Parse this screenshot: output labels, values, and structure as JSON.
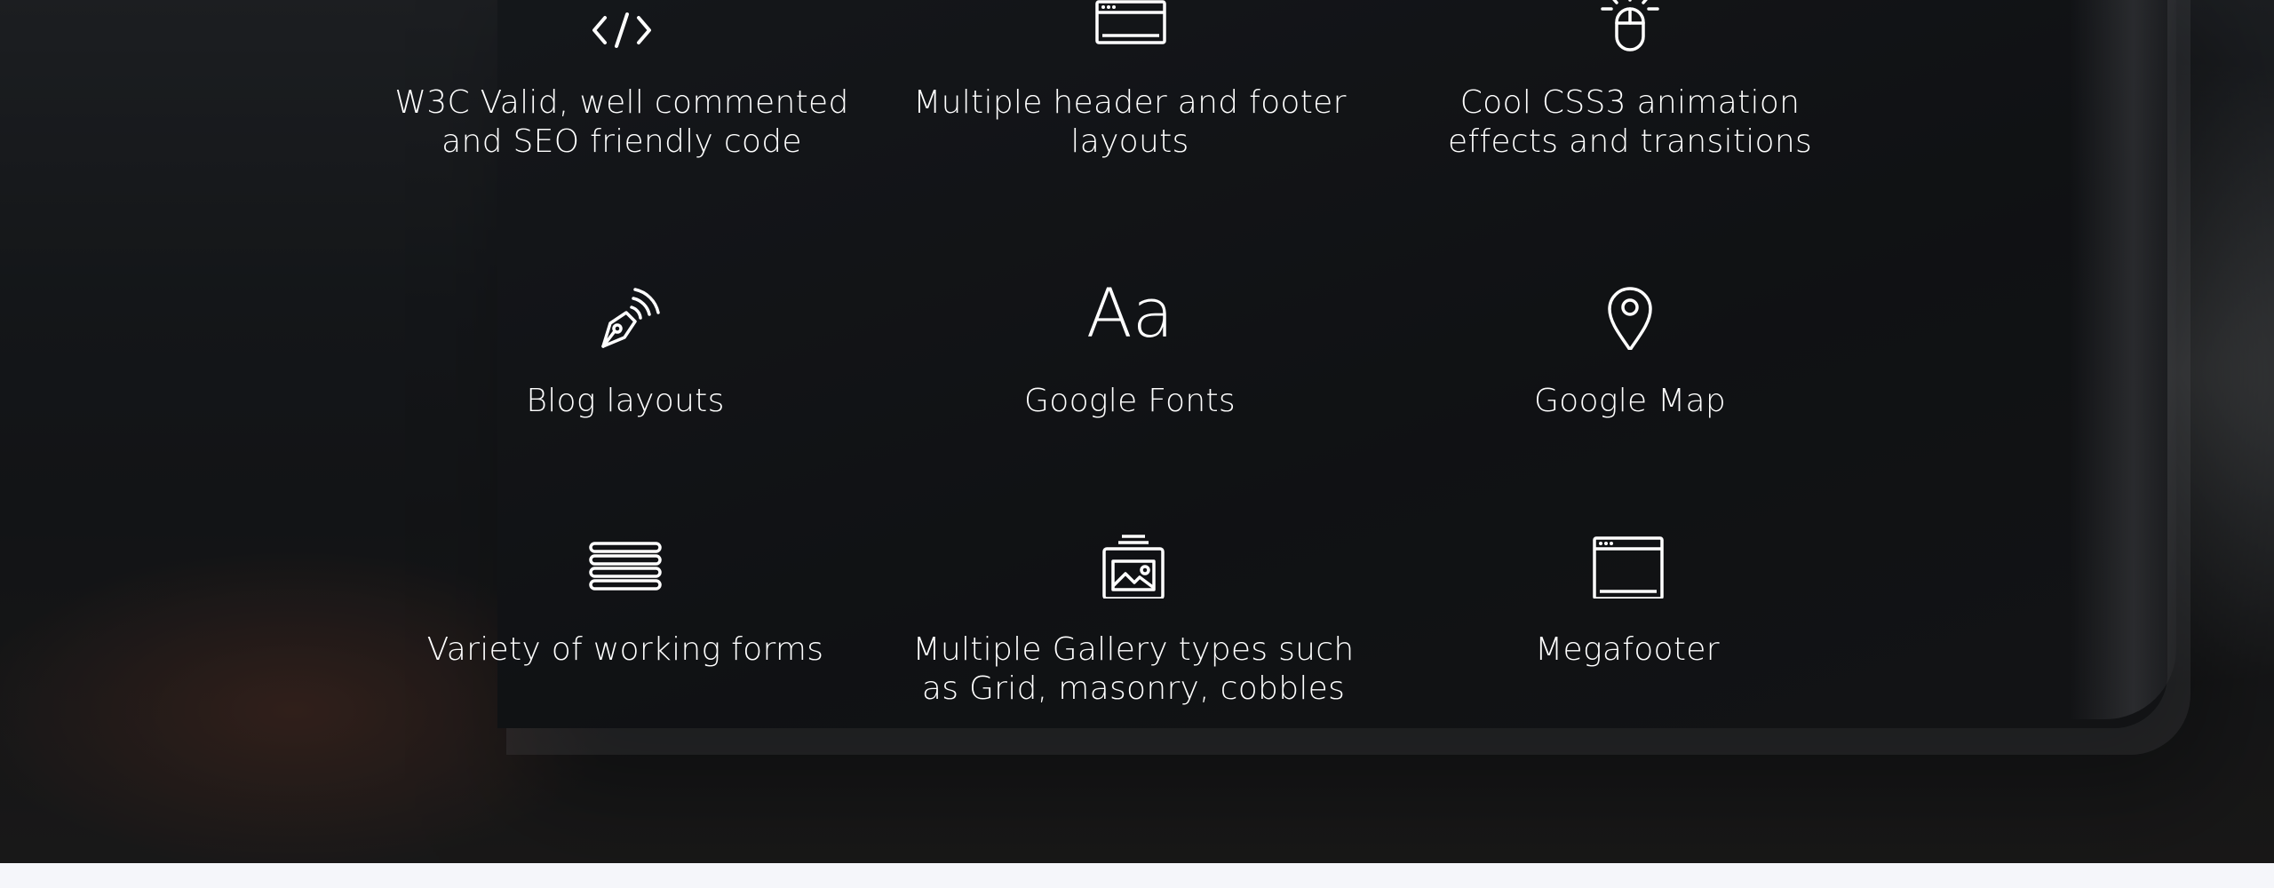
{
  "features": [
    {
      "icon": "code-icon",
      "label": "W3C Valid, well commented\nand SEO friendly code"
    },
    {
      "icon": "browser-window-icon",
      "label": "Multiple header and footer\nlayouts"
    },
    {
      "icon": "mouse-click-icon",
      "label": "Cool CSS3 animation\neffects and transitions"
    },
    {
      "icon": "pen-nib-signal-icon",
      "label": "Blog layouts"
    },
    {
      "icon": "font-icon",
      "glyph": "Aa",
      "label": "Google Fonts"
    },
    {
      "icon": "map-pin-icon",
      "label": "Google Map"
    },
    {
      "icon": "menu-lines-icon",
      "label": "Variety of working forms"
    },
    {
      "icon": "image-gallery-icon",
      "label": "Multiple Gallery types such\nas Grid, masonry, cobbles"
    },
    {
      "icon": "browser-window-icon",
      "label": "Megafooter"
    }
  ],
  "colors": {
    "text": "#ffffff",
    "section_background": "#1c1e21",
    "page_background": "#f5f6fa"
  }
}
